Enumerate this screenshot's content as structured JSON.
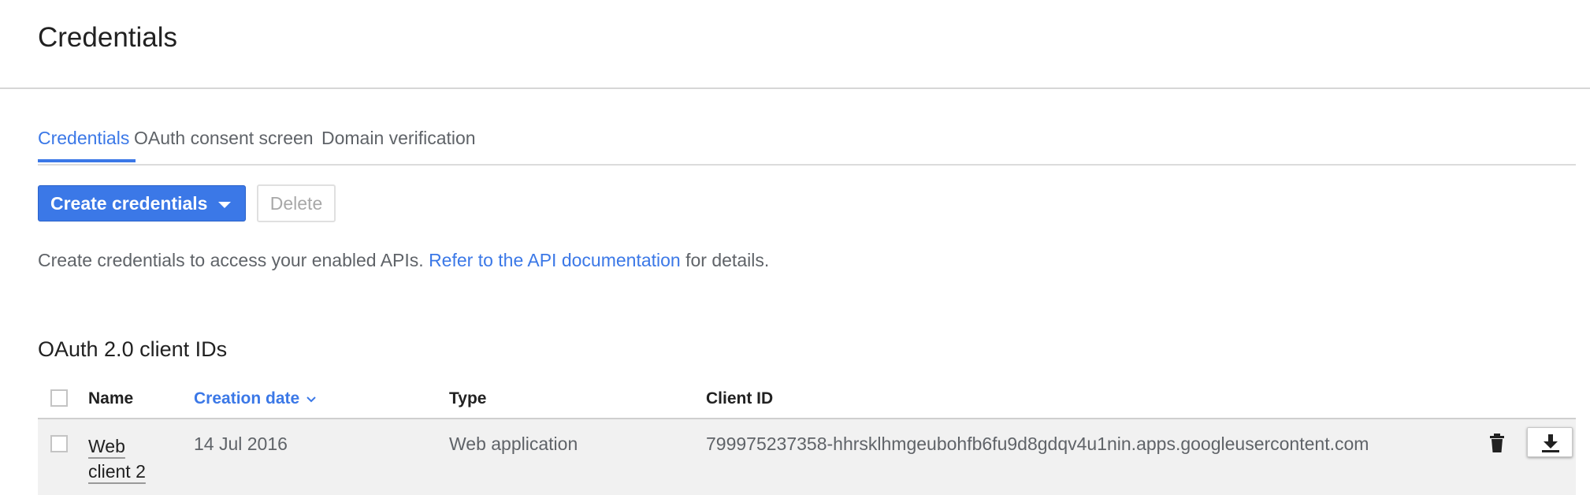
{
  "page": {
    "title": "Credentials"
  },
  "tabs": [
    {
      "label": "Credentials",
      "active": true
    },
    {
      "label": "OAuth consent screen",
      "active": false
    },
    {
      "label": "Domain verification",
      "active": false
    }
  ],
  "toolbar": {
    "create_label": "Create credentials",
    "delete_label": "Delete"
  },
  "info": {
    "prefix": "Create credentials to access your enabled APIs.",
    "link_text": "Refer to the API documentation",
    "suffix": "for details."
  },
  "oauth_section": {
    "title": "OAuth 2.0 client IDs",
    "columns": [
      "Name",
      "Creation date",
      "Type",
      "Client ID"
    ],
    "sorted_column": "Creation date",
    "rows": [
      {
        "name_line1": "Web",
        "name_line2": "client 2",
        "creation_date": "14 Jul 2016",
        "type": "Web application",
        "client_id": "799975237358-hhrsklhmgeubohfb6fu9d8gdqv4u1nin.apps.googleusercontent.com"
      }
    ]
  },
  "colors": {
    "accent": "#3b78e7",
    "text_primary": "#212121",
    "text_secondary": "#5f6368",
    "row_background": "#f1f1f1"
  },
  "icons": {
    "sort": "chevron-down-icon",
    "delete": "trash-icon",
    "download": "download-icon"
  }
}
